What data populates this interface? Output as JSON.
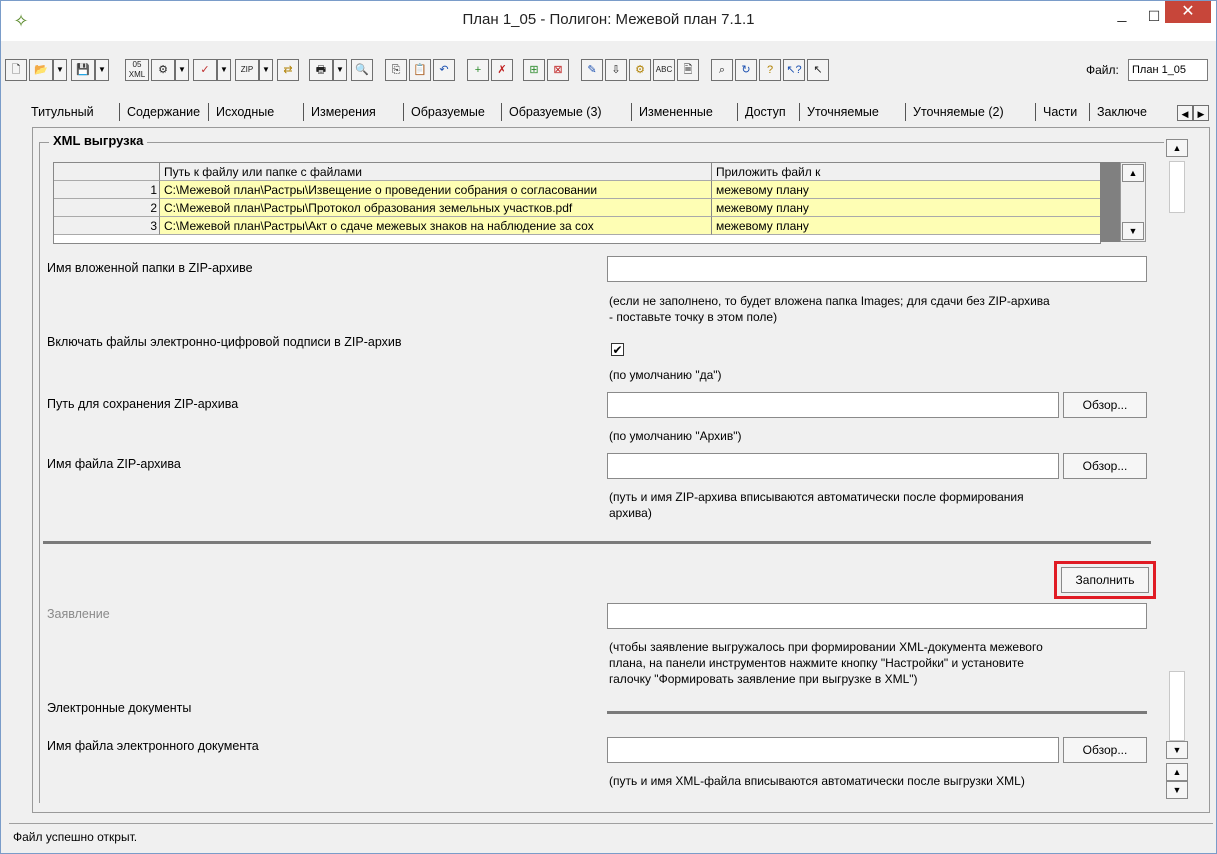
{
  "window": {
    "title": "План 1_05 - Полигон: Межевой план 7.1.1",
    "min_glyph": "_",
    "max_glyph": "☐",
    "close_glyph": "✕"
  },
  "toolbar": {
    "file_label": "Файл:",
    "file_value": "План 1_05",
    "icons": {
      "xml05": "05 XML",
      "zip": "ZIP",
      "abc": "ABC"
    }
  },
  "tabs": [
    "Титульный",
    "Содержание",
    "Исходные",
    "Измерения",
    "Образуемые",
    "Образуемые (3)",
    "Измененные",
    "Доступ",
    "Уточняемые",
    "Уточняемые (2)",
    "Части",
    "Заключе"
  ],
  "section_title": "XML выгрузка",
  "grid": {
    "columns": [
      "Путь к файлу или папке с файлами",
      "Приложить файл к"
    ],
    "rows": [
      {
        "n": "1",
        "path": "C:\\Межевой план\\Растры\\Извещение о проведении собрания о согласовании",
        "attach": "межевому плану"
      },
      {
        "n": "2",
        "path": "C:\\Межевой план\\Растры\\Протокол образования земельных участков.pdf",
        "attach": "межевому плану"
      },
      {
        "n": "3",
        "path": "C:\\Межевой план\\Растры\\Акт о сдаче межевых знаков на наблюдение за сох",
        "attach": "межевому плану"
      }
    ]
  },
  "fields": {
    "zip_folder_label": "Имя вложенной папки в ZIP-архиве",
    "zip_folder_value": "",
    "zip_folder_hint1": "(если не заполнено, то будет вложена папка Images; для сдачи без ZIP-архива",
    "zip_folder_hint2": "- поставьте точку в этом поле)",
    "sign_label": "Включать файлы электронно-цифровой подписи в ZIP-архив",
    "sign_checked": "✔",
    "sign_hint": "(по умолчанию \"да\")",
    "save_path_label": "Путь для сохранения ZIP-архива",
    "save_path_value": "",
    "save_path_hint": "(по умолчанию \"Архив\")",
    "zip_name_label": "Имя файла ZIP-архива",
    "zip_name_value": "",
    "zip_name_hint1": "(путь и имя ZIP-архива вписываются автоматически после формирования",
    "zip_name_hint2": "архива)",
    "browse": "Обзор...",
    "fill": "Заполнить",
    "statement_label": "Заявление",
    "statement_value": "",
    "statement_hint1": "(чтобы заявление выгружалось при формировании XML-документа межевого",
    "statement_hint2": "плана, на панели инструментов нажмите кнопку \"Настройки\" и установите",
    "statement_hint3": "галочку \"Формировать заявление при выгрузке в XML\")",
    "edocs_label": "Электронные документы",
    "edoc_name_label": "Имя файла электронного документа",
    "edoc_name_value": "",
    "edoc_name_hint": "(путь и имя XML-файла вписываются автоматически после выгрузки XML)"
  },
  "status": "Файл успешно открыт."
}
